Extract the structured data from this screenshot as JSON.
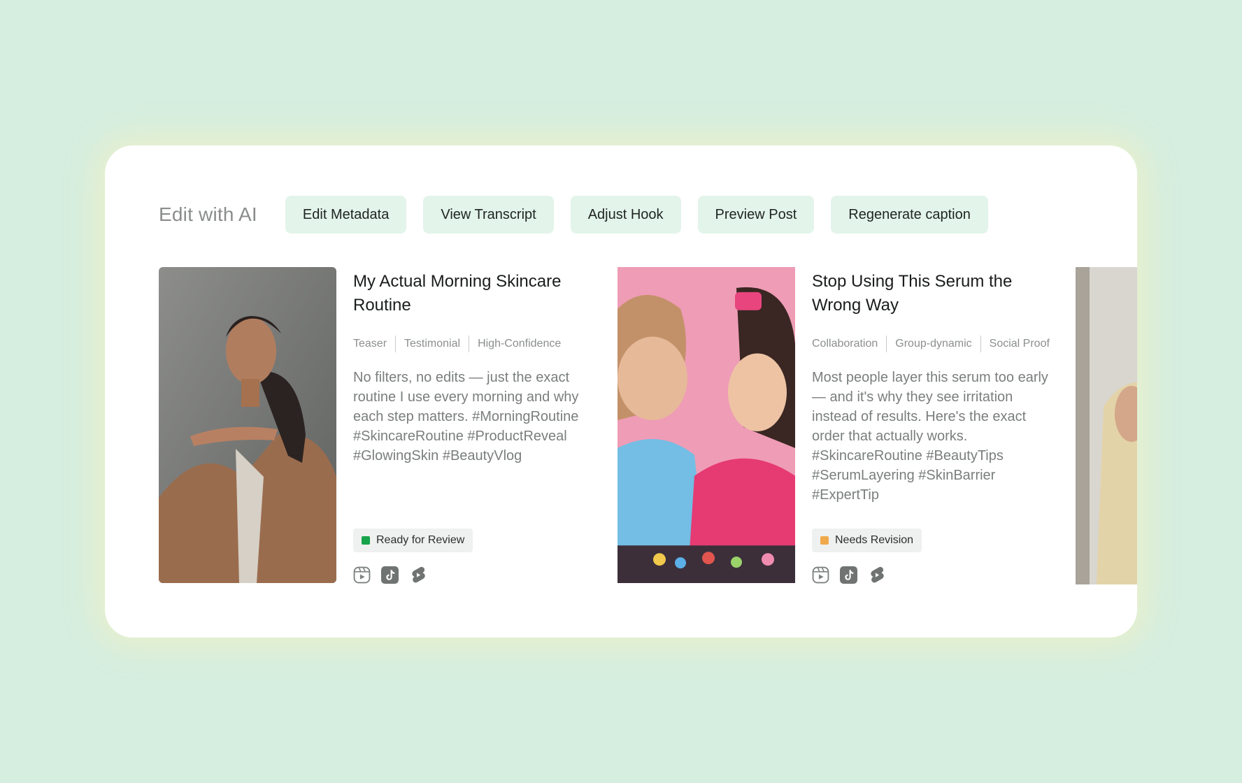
{
  "toolbar": {
    "title": "Edit with AI",
    "actions": [
      {
        "label": "Edit Metadata"
      },
      {
        "label": "View Transcript"
      },
      {
        "label": "Adjust Hook"
      },
      {
        "label": "Preview Post"
      },
      {
        "label": "Regenerate caption"
      }
    ]
  },
  "posts": [
    {
      "title": "My Actual Morning Skincare Routine",
      "tags": [
        "Teaser",
        "Testimonial",
        "High-Confidence"
      ],
      "description": "No filters, no edits — just the exact routine I use every morning and why each step matters. #MorningRoutine #SkincareRoutine #ProductReveal #GlowingSkin #BeautyVlog",
      "status": {
        "label": "Ready for Review",
        "color": "#16a34a"
      },
      "platforms": [
        "instagram-reels-icon",
        "tiktok-icon",
        "youtube-shorts-icon"
      ]
    },
    {
      "title": "Stop Using This Serum the Wrong Way",
      "tags": [
        "Collaboration",
        "Group-dynamic",
        "Social Proof"
      ],
      "description": "Most people layer this serum too early — and it's why they see irritation instead of results. Here's the exact order that actually works. #SkincareRoutine #BeautyTips #SerumLayering #SkinBarrier #ExpertTip",
      "status": {
        "label": "Needs Revision",
        "color": "#f0a94a"
      },
      "platforms": [
        "instagram-reels-icon",
        "tiktok-icon",
        "youtube-shorts-icon"
      ]
    }
  ],
  "colors": {
    "background": "#d5eee0",
    "card": "#ffffff",
    "chip": "#e3f4ea"
  }
}
